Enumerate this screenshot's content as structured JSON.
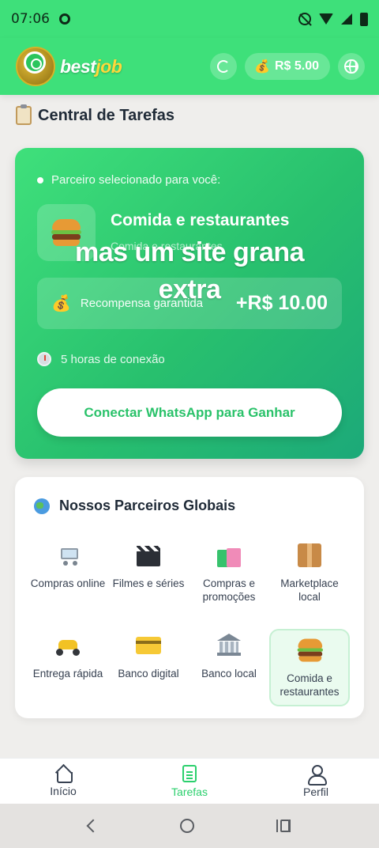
{
  "status_bar": {
    "time": "07:06"
  },
  "header": {
    "logo_main": "best",
    "logo_accent": "job",
    "balance": "R$ 5.00"
  },
  "section": {
    "title": "Central de Tarefas"
  },
  "task": {
    "selected_label": "Parceiro selecionado para você:",
    "partner_name": "Comida e restaurantes",
    "partner_subtitle": "Comida e restaurantes",
    "reward_label": "Recompensa garantida",
    "reward_value": "+R$ 10.00",
    "duration": "5 horas de conexão",
    "connect_button": "Conectar WhatsApp para Ganhar"
  },
  "overlay_caption": {
    "line1": "mas um site grana",
    "line2": "extra"
  },
  "partners": {
    "title": "Nossos Parceiros Globais",
    "items": [
      {
        "label": "Compras online",
        "icon": "shopping-cart-icon"
      },
      {
        "label": "Filmes e séries",
        "icon": "clapperboard-icon"
      },
      {
        "label": "Compras e promoções",
        "icon": "shopping-bags-icon"
      },
      {
        "label": "Marketplace local",
        "icon": "package-icon"
      },
      {
        "label": "Entrega rápida",
        "icon": "scooter-icon"
      },
      {
        "label": "Banco digital",
        "icon": "credit-card-icon"
      },
      {
        "label": "Banco local",
        "icon": "bank-icon"
      },
      {
        "label": "Comida e restaurantes",
        "icon": "hamburger-icon",
        "selected": true
      }
    ]
  },
  "bottom_nav": {
    "items": [
      {
        "label": "Início",
        "icon": "home-icon"
      },
      {
        "label": "Tarefas",
        "icon": "document-icon",
        "active": true
      },
      {
        "label": "Perfil",
        "icon": "user-icon"
      }
    ]
  },
  "colors": {
    "brand_green": "#3ee07a",
    "card_gradient_end": "#1ca979",
    "active_nav": "#2bd06d"
  }
}
